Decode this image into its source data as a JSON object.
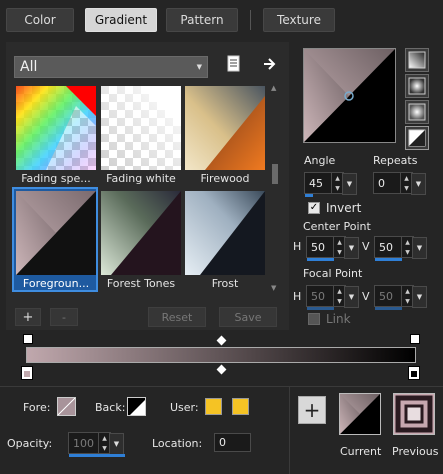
{
  "tabs": [
    {
      "label": "Color",
      "active": false
    },
    {
      "label": "Gradient",
      "active": true
    },
    {
      "label": "Pattern",
      "active": false
    },
    {
      "label": "Texture",
      "active": false
    }
  ],
  "category": {
    "value": "All"
  },
  "presets": [
    {
      "name": "Fading spe..."
    },
    {
      "name": "Fading white"
    },
    {
      "name": "Firewood"
    },
    {
      "name": "Foregroun...",
      "selected": true
    },
    {
      "name": "Forest Tones"
    },
    {
      "name": "Frost"
    }
  ],
  "preset_buttons": {
    "add": "+",
    "remove": "-",
    "reset": "Reset",
    "save": "Save"
  },
  "angle": {
    "label": "Angle",
    "value": "45"
  },
  "repeats": {
    "label": "Repeats",
    "value": "0"
  },
  "invert": {
    "label": "Invert",
    "checked": true
  },
  "center_point": {
    "label": "Center Point",
    "h_label": "H",
    "h": "50",
    "v_label": "V",
    "v": "50"
  },
  "focal_point": {
    "label": "Focal Point",
    "h_label": "H",
    "h": "50",
    "v_label": "V",
    "v": "50"
  },
  "link": {
    "label": "Link",
    "checked": false
  },
  "fore": {
    "label": "Fore:",
    "color": "#a8939a"
  },
  "back": {
    "label": "Back:",
    "color": "#000000"
  },
  "user": {
    "label": "User:",
    "colors": [
      "#f5c324",
      "#f5c324"
    ]
  },
  "opacity": {
    "label": "Opacity:",
    "value": "100"
  },
  "location": {
    "label": "Location:",
    "value": "0"
  },
  "add_button": {
    "label": "+"
  },
  "current": {
    "label": "Current"
  },
  "previous": {
    "label": "Previous"
  },
  "colors": {
    "accent": "#2f7fd6",
    "gradient_start": "#c0a8ad",
    "gradient_end": "#000000"
  }
}
